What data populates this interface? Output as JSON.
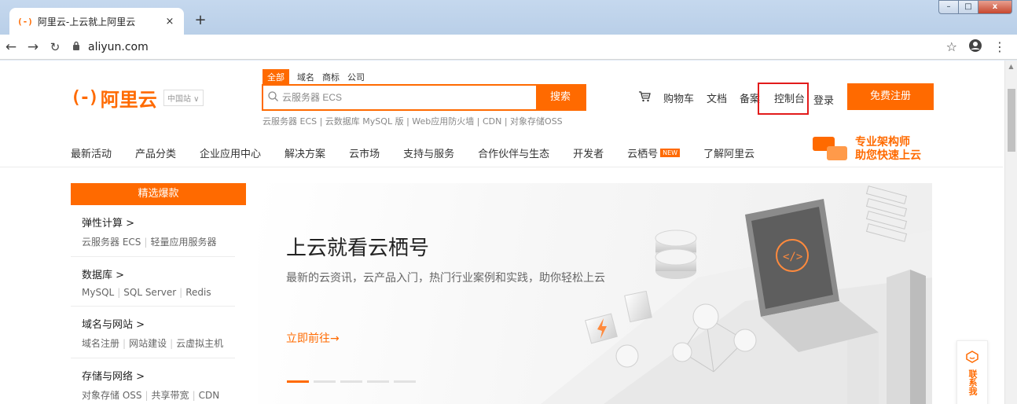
{
  "browser": {
    "tab_title": "阿里云-上云就上阿里云",
    "tab_favicon": "(-)",
    "new_tab": "+",
    "url": "aliyun.com"
  },
  "header": {
    "logo_text": "阿里云",
    "site_select": "中国站 ∨",
    "search_tabs": [
      "全部",
      "域名",
      "商标",
      "公司"
    ],
    "search_placeholder": "云服务器 ECS",
    "search_button": "搜索",
    "hot_links": "云服务器 ECS | 云数据库 MySQL 版 | Web应用防火墙 | CDN | 对象存储OSS",
    "top_links": {
      "cart": "购物车",
      "docs": "文档",
      "icp": "备案",
      "console": "控制台",
      "login": "登录",
      "register": "免费注册"
    },
    "nav": [
      "最新活动",
      "产品分类",
      "企业应用中心",
      "解决方案",
      "云市场",
      "支持与服务",
      "合作伙伴与生态",
      "开发者",
      "云栖号",
      "了解阿里云"
    ],
    "nav_badge": "NEW",
    "promo_line1": "专业架构师",
    "promo_line2": "助您快速上云"
  },
  "sidebar": {
    "head": "精选爆款",
    "sections": [
      {
        "title": "弹性计算 >",
        "links": [
          "云服务器 ECS",
          "轻量应用服务器"
        ]
      },
      {
        "title": "数据库 >",
        "links": [
          "MySQL",
          "SQL Server",
          "Redis"
        ]
      },
      {
        "title": "域名与网站 >",
        "links": [
          "域名注册",
          "网站建设",
          "云虚拟主机"
        ]
      },
      {
        "title": "存储与网络 >",
        "links": [
          "对象存储 OSS",
          "共享带宽",
          "CDN"
        ]
      }
    ]
  },
  "banner": {
    "title": "上云就看云栖号",
    "subtitle": "最新的云资讯，云产品入门，热门行业案例和实践，助你轻松上云",
    "cta": "立即前往→",
    "slide_count": 5,
    "active_slide": 1
  },
  "contact": {
    "text": "联系我"
  },
  "colors": {
    "accent": "#ff6a00",
    "highlight": "#e21b1b"
  },
  "icons": [
    "back-arrow-icon",
    "forward-arrow-icon",
    "reload-icon",
    "lock-icon",
    "star-icon",
    "profile-icon",
    "menu-icon",
    "search-icon",
    "cart-icon",
    "chat-icon"
  ]
}
